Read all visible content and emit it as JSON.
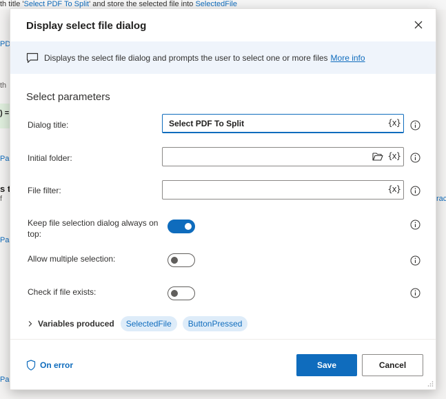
{
  "background": {
    "top_prefix": "th title '",
    "top_title": "Select PDF To Split",
    "top_mid": "' and store the selected file into ",
    "top_var": "SelectedFile"
  },
  "dialog": {
    "title": "Display select file dialog",
    "close_icon": "close-icon",
    "info": {
      "description": "Displays the select file dialog and prompts the user to select one or more files",
      "more_info": "More info"
    },
    "section_title": "Select parameters",
    "fields": {
      "dialog_title": {
        "label": "Dialog title:",
        "value": "Select PDF To Split"
      },
      "initial_folder": {
        "label": "Initial folder:",
        "value": ""
      },
      "file_filter": {
        "label": "File filter:",
        "value": ""
      }
    },
    "variable_button": "{x}",
    "toggles": {
      "keep_on_top": {
        "label": "Keep file selection dialog always on top:",
        "on": true
      },
      "allow_multiple": {
        "label": "Allow multiple selection:",
        "on": false
      },
      "check_exists": {
        "label": "Check if file exists:",
        "on": false
      }
    },
    "variables_produced": {
      "label": "Variables produced",
      "chips": [
        "SelectedFile",
        "ButtonPressed"
      ]
    },
    "footer": {
      "on_error": "On error",
      "save": "Save",
      "cancel": "Cancel"
    }
  },
  "colors": {
    "accent": "#0f6cbd",
    "banner_bg": "#eff4fb",
    "chip_bg": "#deecf9"
  }
}
